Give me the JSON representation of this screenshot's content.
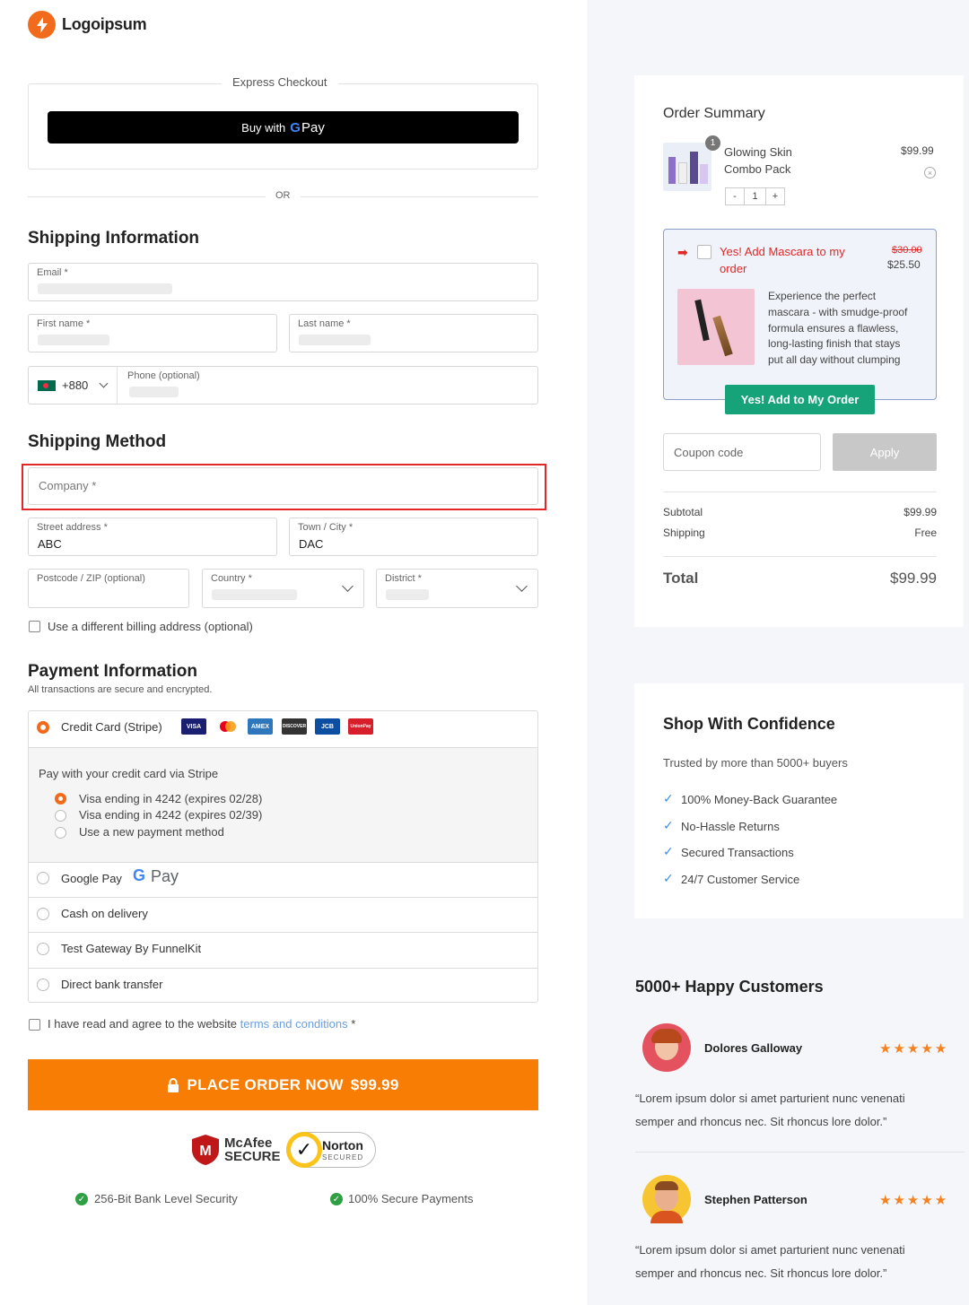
{
  "brand": {
    "name": "Logoipsum"
  },
  "express": {
    "label": "Express Checkout",
    "gpay_prefix": "Buy with",
    "gpay_g": "G",
    "gpay_pay": "Pay",
    "or": "OR"
  },
  "shipping_info": {
    "title": "Shipping Information",
    "email_label": "Email *",
    "first_name_label": "First name *",
    "last_name_label": "Last name *",
    "country_code": "+880",
    "phone_label": "Phone (optional)"
  },
  "shipping_method": {
    "title": "Shipping Method",
    "company_placeholder": "Company *",
    "street_label": "Street address *",
    "street_value": "ABC",
    "town_label": "Town / City *",
    "town_value": "DAC",
    "postcode_label": "Postcode / ZIP (optional)",
    "country_label": "Country *",
    "district_label": "District *",
    "billing_checkbox": "Use a different billing address (optional)"
  },
  "payment": {
    "title": "Payment Information",
    "subtitle": "All transactions are secure and encrypted.",
    "credit_card_label": "Credit Card (Stripe)",
    "card_logos": [
      "VISA",
      "MC",
      "AMEX",
      "DISCOVER",
      "JCB",
      "UnionPay"
    ],
    "stripe_intro": "Pay with your credit card via Stripe",
    "saved_cards": [
      "Visa ending in 4242 (expires 02/28)",
      "Visa ending in 4242 (expires 02/39)",
      "Use a new payment method"
    ],
    "google_pay_label": "Google Pay",
    "google_pay_g": "G",
    "google_pay_pay": "Pay",
    "cod_label": "Cash on delivery",
    "test_gateway_label": "Test Gateway By FunnelKit",
    "bank_label": "Direct bank transfer"
  },
  "terms": {
    "prefix": "I have read and agree to the website",
    "link": "terms and conditions",
    "suffix": "*"
  },
  "place_order": {
    "label": "PLACE ORDER NOW",
    "amount": "$99.99"
  },
  "badges": {
    "mcafee_top": "McAfee",
    "mcafee_bottom": "SECURE",
    "norton_top": "Norton",
    "norton_bottom": "SECURED",
    "security_1": "256-Bit Bank Level Security",
    "security_2": "100% Secure Payments"
  },
  "order_summary": {
    "title": "Order Summary",
    "item_name_line1": "Glowing Skin",
    "item_name_line2": "Combo Pack",
    "item_price": "$99.99",
    "item_qty_badge": "1",
    "qty_minus": "-",
    "qty_value": "1",
    "qty_plus": "+"
  },
  "upsell": {
    "headline_line1": "Yes! Add Mascara to my",
    "headline_line2": "order",
    "old_price": "$30.00",
    "new_price": "$25.50",
    "description": [
      "Experience the perfect",
      "mascara - with smudge-proof",
      "formula ensures a flawless,",
      "long-lasting finish that stays",
      "put all day without clumping"
    ],
    "button": "Yes! Add to My Order"
  },
  "coupon": {
    "placeholder": "Coupon code",
    "apply": "Apply"
  },
  "totals": {
    "subtotal_label": "Subtotal",
    "subtotal_value": "$99.99",
    "shipping_label": "Shipping",
    "shipping_value": "Free",
    "total_label": "Total",
    "total_value": "$99.99"
  },
  "confidence": {
    "title": "Shop With Confidence",
    "subtitle": "Trusted by more than 5000+ buyers",
    "items": [
      "100% Money-Back Guarantee",
      "No-Hassle Returns",
      "Secured Transactions",
      "24/7 Customer Service"
    ]
  },
  "testimonials": {
    "title": "5000+ Happy Customers",
    "items": [
      {
        "name": "Dolores Galloway",
        "stars": "★★★★★",
        "line1": "“Lorem ipsum dolor si amet parturient nunc venenati",
        "line2": "semper and rhoncus nec. Sit rhoncus lore dolor.”"
      },
      {
        "name": "Stephen Patterson",
        "stars": "★★★★★",
        "line1": "“Lorem ipsum dolor si amet parturient nunc venenati",
        "line2": "semper and rhoncus nec. Sit rhoncus lore dolor.”"
      }
    ]
  },
  "colors": {
    "accent": "#f77d04",
    "highlight": "#e32626",
    "green_button": "#16a37a",
    "check_blue": "#3b8ee8"
  }
}
